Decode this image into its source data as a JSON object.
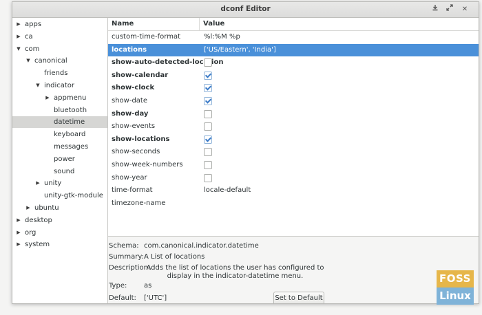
{
  "window": {
    "title": "dconf Editor",
    "buttons": [
      "download-icon",
      "expand-icon",
      "close-icon"
    ],
    "close_glyph": "✕"
  },
  "tree": [
    {
      "label": "apps",
      "arrow": "▶"
    },
    {
      "label": "ca",
      "arrow": "▶"
    },
    {
      "label": "com",
      "arrow": "▼"
    },
    {
      "label": "canonical",
      "arrow": "▼"
    },
    {
      "label": "friends",
      "arrow": ""
    },
    {
      "label": "indicator",
      "arrow": "▼"
    },
    {
      "label": "appmenu",
      "arrow": "▶"
    },
    {
      "label": "bluetooth",
      "arrow": ""
    },
    {
      "label": "datetime",
      "arrow": "",
      "selected": true
    },
    {
      "label": "keyboard",
      "arrow": ""
    },
    {
      "label": "messages",
      "arrow": ""
    },
    {
      "label": "power",
      "arrow": ""
    },
    {
      "label": "sound",
      "arrow": ""
    },
    {
      "label": "unity",
      "arrow": "▶"
    },
    {
      "label": "unity-gtk-module",
      "arrow": ""
    },
    {
      "label": "ubuntu",
      "arrow": "▶"
    },
    {
      "label": "desktop",
      "arrow": "▶"
    },
    {
      "label": "org",
      "arrow": "▶"
    },
    {
      "label": "system",
      "arrow": "▶"
    }
  ],
  "grid": {
    "headers": {
      "name": "Name",
      "value": "Value"
    },
    "rows": [
      {
        "name": "custom-time-format",
        "value": "%l:%M %p",
        "type": "text",
        "bold": false
      },
      {
        "name": "locations",
        "value": "['US/Eastern', 'India']",
        "type": "text",
        "bold": true,
        "selected": true
      },
      {
        "name": "show-auto-detected-location",
        "type": "check",
        "checked": false,
        "bold": true
      },
      {
        "name": "show-calendar",
        "type": "check",
        "checked": true,
        "bold": true
      },
      {
        "name": "show-clock",
        "type": "check",
        "checked": true,
        "bold": true
      },
      {
        "name": "show-date",
        "type": "check",
        "checked": true,
        "bold": false
      },
      {
        "name": "show-day",
        "type": "check",
        "checked": false,
        "bold": true
      },
      {
        "name": "show-events",
        "type": "check",
        "checked": false,
        "bold": false
      },
      {
        "name": "show-locations",
        "type": "check",
        "checked": true,
        "bold": true
      },
      {
        "name": "show-seconds",
        "type": "check",
        "checked": false,
        "bold": false
      },
      {
        "name": "show-week-numbers",
        "type": "check",
        "checked": false,
        "bold": false
      },
      {
        "name": "show-year",
        "type": "check",
        "checked": false,
        "bold": false
      },
      {
        "name": "time-format",
        "value": "locale-default",
        "type": "text",
        "bold": false
      },
      {
        "name": "timezone-name",
        "value": "",
        "type": "text",
        "bold": false
      }
    ]
  },
  "info": {
    "schema_label": "Schema:",
    "schema": "com.canonical.indicator.datetime",
    "summary_label": "Summary:",
    "summary": "A List of locations",
    "description_label": "Description:",
    "description": "Adds the list of locations the user has configured to display in the indicator-datetime menu.",
    "type_label": "Type:",
    "type": "as",
    "default_label": "Default:",
    "default": "['UTC']",
    "set_default_label": "Set to Default"
  },
  "watermark": {
    "top": "FOSS",
    "bottom": "Linux"
  },
  "colors": {
    "selection": "#4a90d9",
    "sidebar_selection": "#d6d6d4",
    "logo_top": "#e6b64a",
    "logo_bottom": "#7fb3d8"
  }
}
